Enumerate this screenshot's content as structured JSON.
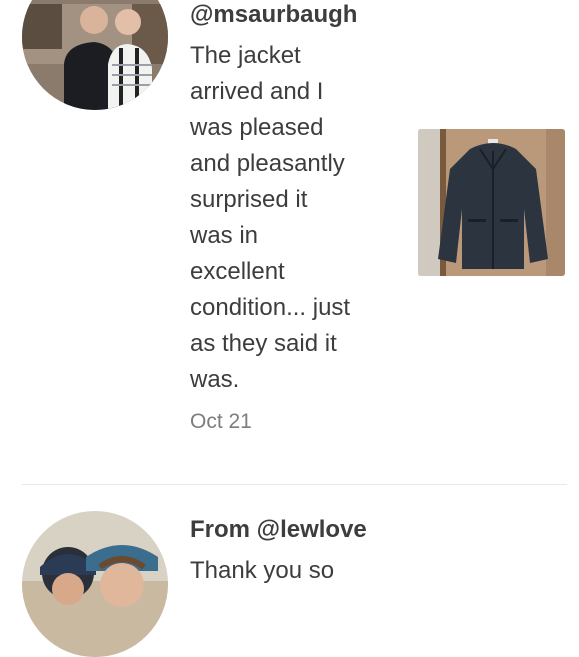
{
  "reviews": [
    {
      "handle": "@msaurbaugh",
      "text_lines": [
        "The jacket",
        "arrived and I",
        "was pleased",
        "and pleasantly",
        "surprised it",
        "was in",
        "excellent",
        "condition... just",
        "as they said it",
        "was."
      ],
      "date": "Oct 21"
    },
    {
      "handle": "From @lewlove",
      "text_lines": [
        "Thank you so"
      ]
    }
  ]
}
